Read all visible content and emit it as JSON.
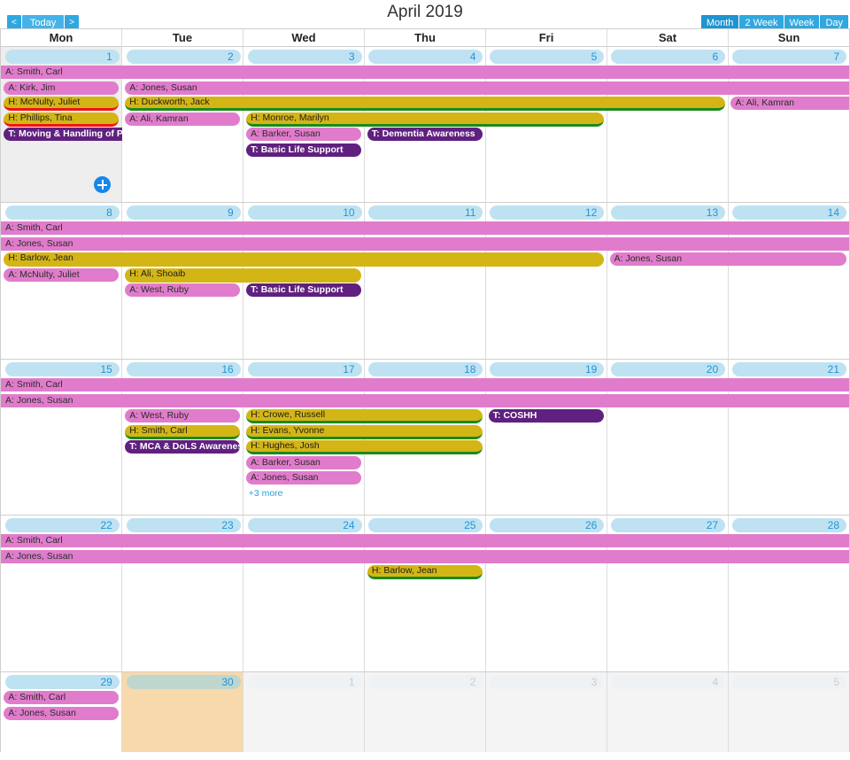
{
  "toolbar": {
    "title": "April 2019",
    "prev_label": "<",
    "today_label": "Today",
    "next_label": ">",
    "views": [
      {
        "label": "Month",
        "active": true
      },
      {
        "label": "2 Week",
        "active": false
      },
      {
        "label": "Week",
        "active": false
      },
      {
        "label": "Day",
        "active": false
      }
    ],
    "accent_color": "#2fa8e0"
  },
  "day_headers": [
    "Mon",
    "Tue",
    "Wed",
    "Thu",
    "Fri",
    "Sat",
    "Sun"
  ],
  "colors": {
    "appointment": "#e07ccb",
    "holiday": "#d4b516",
    "training": "#60207f",
    "holiday_border_green": "#1a8a1a",
    "holiday_border_red": "#f01414",
    "date_pill": "#bfe2f2",
    "date_number": "#2196d6",
    "today_cell": "#f7d9ab",
    "hovered_cell": "#eeeeee",
    "other_month_cell": "#f4f4f4"
  },
  "weeks": [
    {
      "dates": [
        {
          "num": "1",
          "state": "hovered",
          "add_button": true
        },
        {
          "num": "2",
          "state": "normal"
        },
        {
          "num": "3",
          "state": "normal"
        },
        {
          "num": "4",
          "state": "normal"
        },
        {
          "num": "5",
          "state": "normal"
        },
        {
          "num": "6",
          "state": "normal"
        },
        {
          "num": "7",
          "state": "normal"
        }
      ],
      "events": [
        {
          "label": "A: Smith, Carl",
          "type": "appointment",
          "start": 0,
          "span": 7,
          "row": 0,
          "round_left": false,
          "round_right": false
        },
        {
          "label": "A: Kirk, Jim",
          "type": "appointment",
          "start": 0,
          "span": 1,
          "row": 1,
          "round_left": true,
          "round_right": true
        },
        {
          "label": "A: Jones, Susan",
          "type": "appointment",
          "start": 1,
          "span": 6,
          "row": 1,
          "round_left": true,
          "round_right": false
        },
        {
          "label": "H: McNulty, Juliet",
          "type": "holiday",
          "border": "red",
          "start": 0,
          "span": 1,
          "row": 2,
          "round_left": true,
          "round_right": true
        },
        {
          "label": "H: Duckworth, Jack",
          "type": "holiday",
          "border": "green",
          "start": 1,
          "span": 5,
          "row": 2,
          "round_left": true,
          "round_right": true
        },
        {
          "label": "A: Ali, Kamran",
          "type": "appointment",
          "start": 6,
          "span": 1,
          "row": 2,
          "round_left": true,
          "round_right": false
        },
        {
          "label": "H: Phillips, Tina",
          "type": "holiday",
          "border": "red",
          "start": 0,
          "span": 1,
          "row": 3,
          "round_left": true,
          "round_right": true
        },
        {
          "label": "A: Ali, Kamran",
          "type": "appointment",
          "start": 1,
          "span": 1,
          "row": 3,
          "round_left": true,
          "round_right": true
        },
        {
          "label": "H: Monroe, Marilyn",
          "type": "holiday",
          "border": "green",
          "start": 2,
          "span": 3,
          "row": 3,
          "round_left": true,
          "round_right": true
        },
        {
          "label": "T: Moving & Handling of People",
          "type": "training",
          "start": 0,
          "span": 1,
          "row": 4,
          "round_left": true,
          "round_right": false
        },
        {
          "label": "A: Barker, Susan",
          "type": "appointment",
          "start": 2,
          "span": 1,
          "row": 4,
          "round_left": true,
          "round_right": true
        },
        {
          "label": "T: Dementia Awareness",
          "type": "training",
          "start": 3,
          "span": 1,
          "row": 4,
          "round_left": true,
          "round_right": true
        },
        {
          "label": "T: Basic Life Support",
          "type": "training",
          "start": 2,
          "span": 1,
          "row": 5,
          "round_left": true,
          "round_right": true
        }
      ]
    },
    {
      "dates": [
        {
          "num": "8",
          "state": "normal"
        },
        {
          "num": "9",
          "state": "normal"
        },
        {
          "num": "10",
          "state": "normal"
        },
        {
          "num": "11",
          "state": "normal"
        },
        {
          "num": "12",
          "state": "normal"
        },
        {
          "num": "13",
          "state": "normal"
        },
        {
          "num": "14",
          "state": "normal"
        }
      ],
      "events": [
        {
          "label": "A: Smith, Carl",
          "type": "appointment",
          "start": 0,
          "span": 7,
          "row": 0,
          "round_left": false,
          "round_right": false
        },
        {
          "label": "A: Jones, Susan",
          "type": "appointment",
          "start": 0,
          "span": 7,
          "row": 1,
          "round_left": false,
          "round_right": false
        },
        {
          "label": "H: Barlow, Jean",
          "type": "holiday",
          "border": "none",
          "start": 0,
          "span": 5,
          "row": 2,
          "round_left": true,
          "round_right": true
        },
        {
          "label": "A: Jones, Susan",
          "type": "appointment",
          "start": 5,
          "span": 2,
          "row": 2,
          "round_left": true,
          "round_right": true
        },
        {
          "label": "A: McNulty, Juliet",
          "type": "appointment",
          "start": 0,
          "span": 1,
          "row": 3,
          "round_left": true,
          "round_right": true
        },
        {
          "label": "H: Ali, Shoaib",
          "type": "holiday",
          "border": "none",
          "start": 1,
          "span": 2,
          "row": 3,
          "round_left": true,
          "round_right": true
        },
        {
          "label": "A: West, Ruby",
          "type": "appointment",
          "start": 1,
          "span": 1,
          "row": 4,
          "round_left": true,
          "round_right": true
        },
        {
          "label": "T: Basic Life Support",
          "type": "training",
          "start": 2,
          "span": 1,
          "row": 4,
          "round_left": true,
          "round_right": true
        }
      ]
    },
    {
      "dates": [
        {
          "num": "15",
          "state": "normal"
        },
        {
          "num": "16",
          "state": "normal"
        },
        {
          "num": "17",
          "state": "normal"
        },
        {
          "num": "18",
          "state": "normal"
        },
        {
          "num": "19",
          "state": "normal"
        },
        {
          "num": "20",
          "state": "normal"
        },
        {
          "num": "21",
          "state": "normal"
        }
      ],
      "events": [
        {
          "label": "A: Smith, Carl",
          "type": "appointment",
          "start": 0,
          "span": 7,
          "row": 0,
          "round_left": false,
          "round_right": false
        },
        {
          "label": "A: Jones, Susan",
          "type": "appointment",
          "start": 0,
          "span": 7,
          "row": 1,
          "round_left": false,
          "round_right": false
        },
        {
          "label": "A: West, Ruby",
          "type": "appointment",
          "start": 1,
          "span": 1,
          "row": 2,
          "round_left": true,
          "round_right": true
        },
        {
          "label": "H: Crowe, Russell",
          "type": "holiday",
          "border": "green",
          "start": 2,
          "span": 2,
          "row": 2,
          "round_left": true,
          "round_right": true
        },
        {
          "label": "T: COSHH",
          "type": "training",
          "start": 4,
          "span": 1,
          "row": 2,
          "round_left": true,
          "round_right": true
        },
        {
          "label": "H: Smith, Carl",
          "type": "holiday",
          "border": "green",
          "start": 1,
          "span": 1,
          "row": 3,
          "round_left": true,
          "round_right": true
        },
        {
          "label": "H: Evans, Yvonne",
          "type": "holiday",
          "border": "green",
          "start": 2,
          "span": 2,
          "row": 3,
          "round_left": true,
          "round_right": true
        },
        {
          "label": "T: MCA & DoLS Awareness",
          "type": "training",
          "start": 1,
          "span": 1,
          "row": 4,
          "round_left": true,
          "round_right": true
        },
        {
          "label": "H: Hughes, Josh",
          "type": "holiday",
          "border": "green",
          "start": 2,
          "span": 2,
          "row": 4,
          "round_left": true,
          "round_right": true
        },
        {
          "label": "A: Barker, Susan",
          "type": "appointment",
          "start": 2,
          "span": 1,
          "row": 5,
          "round_left": true,
          "round_right": true
        },
        {
          "label": "A: Jones, Susan",
          "type": "appointment",
          "start": 2,
          "span": 1,
          "row": 6,
          "round_left": true,
          "round_right": true
        }
      ],
      "more": {
        "label": "+3 more",
        "col": 2,
        "row": 7
      }
    },
    {
      "dates": [
        {
          "num": "22",
          "state": "normal"
        },
        {
          "num": "23",
          "state": "normal"
        },
        {
          "num": "24",
          "state": "normal"
        },
        {
          "num": "25",
          "state": "normal"
        },
        {
          "num": "26",
          "state": "normal"
        },
        {
          "num": "27",
          "state": "normal"
        },
        {
          "num": "28",
          "state": "normal"
        }
      ],
      "events": [
        {
          "label": "A: Smith, Carl",
          "type": "appointment",
          "start": 0,
          "span": 7,
          "row": 0,
          "round_left": false,
          "round_right": false
        },
        {
          "label": "A: Jones, Susan",
          "type": "appointment",
          "start": 0,
          "span": 7,
          "row": 1,
          "round_left": false,
          "round_right": false
        },
        {
          "label": "H: Barlow, Jean",
          "type": "holiday",
          "border": "green",
          "start": 3,
          "span": 1,
          "row": 2,
          "round_left": true,
          "round_right": true
        }
      ]
    },
    {
      "dates": [
        {
          "num": "29",
          "state": "normal"
        },
        {
          "num": "30",
          "state": "today"
        },
        {
          "num": "1",
          "state": "other"
        },
        {
          "num": "2",
          "state": "other"
        },
        {
          "num": "3",
          "state": "other"
        },
        {
          "num": "4",
          "state": "other"
        },
        {
          "num": "5",
          "state": "other"
        }
      ],
      "events": [
        {
          "label": "A: Smith, Carl",
          "type": "appointment",
          "start": 0,
          "span": 1,
          "row": 0,
          "round_left": true,
          "round_right": true
        },
        {
          "label": "A: Jones, Susan",
          "type": "appointment",
          "start": 0,
          "span": 1,
          "row": 1,
          "round_left": true,
          "round_right": true
        }
      ]
    }
  ]
}
